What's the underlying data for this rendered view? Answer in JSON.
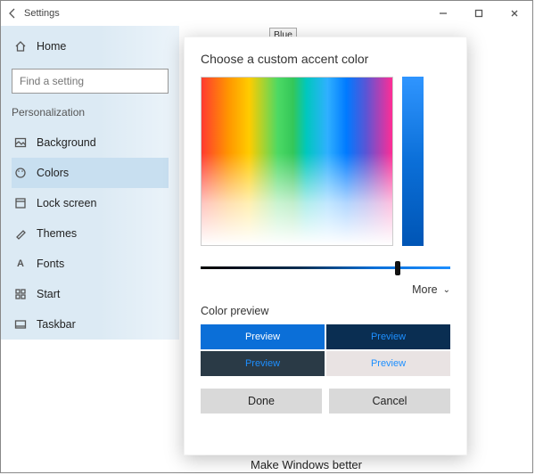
{
  "window": {
    "title": "Settings"
  },
  "sidebar": {
    "home": "Home",
    "search_placeholder": "Find a setting",
    "category": "Personalization",
    "items": [
      {
        "label": "Background"
      },
      {
        "label": "Colors"
      },
      {
        "label": "Lock screen"
      },
      {
        "label": "Themes"
      },
      {
        "label": "Fonts"
      },
      {
        "label": "Start"
      },
      {
        "label": "Taskbar"
      }
    ]
  },
  "dialog": {
    "title": "Choose a custom accent color",
    "tooltip": "Blue",
    "more": "More",
    "preview_label": "Color preview",
    "preview_cells": [
      "Preview",
      "Preview",
      "Preview",
      "Preview"
    ],
    "done": "Done",
    "cancel": "Cancel"
  },
  "footer": {
    "text": "Make Windows better"
  }
}
